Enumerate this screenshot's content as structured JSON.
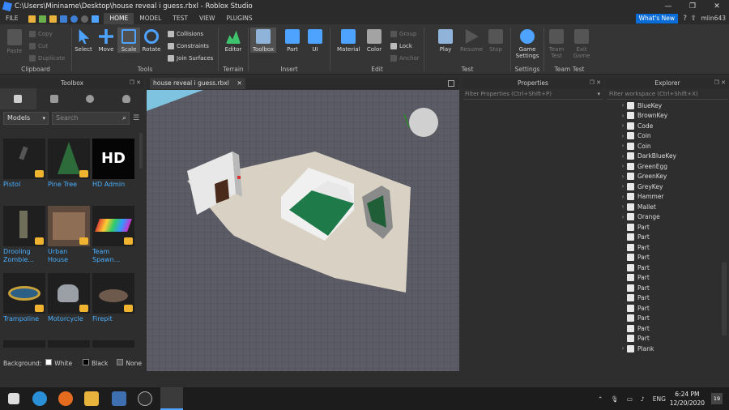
{
  "window": {
    "title": "C:\\Users\\Mininame\\Desktop\\house reveal i guess.rbxl - Roblox Studio",
    "minimize": "—",
    "maximize": "❐",
    "close": "✕"
  },
  "menu": {
    "tabs": [
      "FILE",
      "HOME",
      "MODEL",
      "TEST",
      "VIEW",
      "PLUGINS"
    ],
    "active": "HOME",
    "whats_new": "What's New",
    "user": "mlin643"
  },
  "ribbon": {
    "clipboard": {
      "label": "Clipboard",
      "paste": "Paste",
      "copy": "Copy",
      "cut": "Cut",
      "duplicate": "Duplicate"
    },
    "tools": {
      "label": "Tools",
      "select": "Select",
      "move": "Move",
      "scale": "Scale",
      "rotate": "Rotate",
      "collisions": "Collisions",
      "constraints": "Constraints",
      "join_surfaces": "Join Surfaces"
    },
    "terrain": {
      "label": "Terrain",
      "editor": "Editor"
    },
    "insert": {
      "label": "Insert",
      "toolbox": "Toolbox",
      "part": "Part",
      "ui": "UI"
    },
    "edit": {
      "label": "Edit",
      "material": "Material",
      "color": "Color",
      "group": "Group",
      "lock": "Lock",
      "anchor": "Anchor"
    },
    "test": {
      "label": "Test",
      "play": "Play",
      "resume": "Resume",
      "stop": "Stop"
    },
    "settings": {
      "label": "Settings",
      "game_settings": "Game Settings"
    },
    "team_test": {
      "label": "Team Test",
      "team_test": "Team Test",
      "exit_game": "Exit Game"
    }
  },
  "toolbox": {
    "title": "Toolbox",
    "category": "Models",
    "search_placeholder": "Search",
    "items": [
      {
        "name": "Pistol"
      },
      {
        "name": "Pine Tree"
      },
      {
        "name": "HD Admin",
        "logo": "HD"
      },
      {
        "name": "Drooling Zombie..."
      },
      {
        "name": "Urban House"
      },
      {
        "name": "Team Spawn..."
      },
      {
        "name": "Trampoline"
      },
      {
        "name": "Motorcycle"
      },
      {
        "name": "Firepit"
      }
    ],
    "background_label": "Background:",
    "backgrounds": [
      "White",
      "Black",
      "None"
    ]
  },
  "document_tab": {
    "label": "house reveal i guess.rbxl",
    "close": "✕"
  },
  "properties": {
    "title": "Properties",
    "filter_placeholder": "Filter Properties (Ctrl+Shift+P)"
  },
  "explorer": {
    "title": "Explorer",
    "filter_placeholder": "Filter workspace (Ctrl+Shift+X)",
    "items": [
      {
        "name": "BlueKey",
        "expandable": true
      },
      {
        "name": "BrownKey",
        "expandable": true
      },
      {
        "name": "Code",
        "expandable": true
      },
      {
        "name": "Coin",
        "expandable": true
      },
      {
        "name": "Coin",
        "expandable": true
      },
      {
        "name": "DarkBlueKey",
        "expandable": true
      },
      {
        "name": "GreenEgg",
        "expandable": true
      },
      {
        "name": "GreenKey",
        "expandable": true
      },
      {
        "name": "GreyKey",
        "expandable": true
      },
      {
        "name": "Hammer",
        "expandable": true
      },
      {
        "name": "Mallet",
        "expandable": true
      },
      {
        "name": "Orange",
        "expandable": true
      },
      {
        "name": "Part",
        "expandable": false
      },
      {
        "name": "Part",
        "expandable": false
      },
      {
        "name": "Part",
        "expandable": false
      },
      {
        "name": "Part",
        "expandable": false
      },
      {
        "name": "Part",
        "expandable": false
      },
      {
        "name": "Part",
        "expandable": false
      },
      {
        "name": "Part",
        "expandable": false
      },
      {
        "name": "Part",
        "expandable": false
      },
      {
        "name": "Part",
        "expandable": false
      },
      {
        "name": "Part",
        "expandable": false
      },
      {
        "name": "Part",
        "expandable": false
      },
      {
        "name": "Part",
        "expandable": false
      },
      {
        "name": "Plank",
        "expandable": true
      }
    ]
  },
  "taskbar": {
    "time": "6:24 PM",
    "date": "12/20/2020",
    "lang": "ENG",
    "notifications": "19"
  },
  "colors": {
    "accent": "#0a6cd6",
    "link": "#4ab0ff",
    "badge": "#f0b431",
    "baseplate": "#55555f",
    "floor": "#d9d2c4",
    "bed": "#1f7a4a"
  }
}
